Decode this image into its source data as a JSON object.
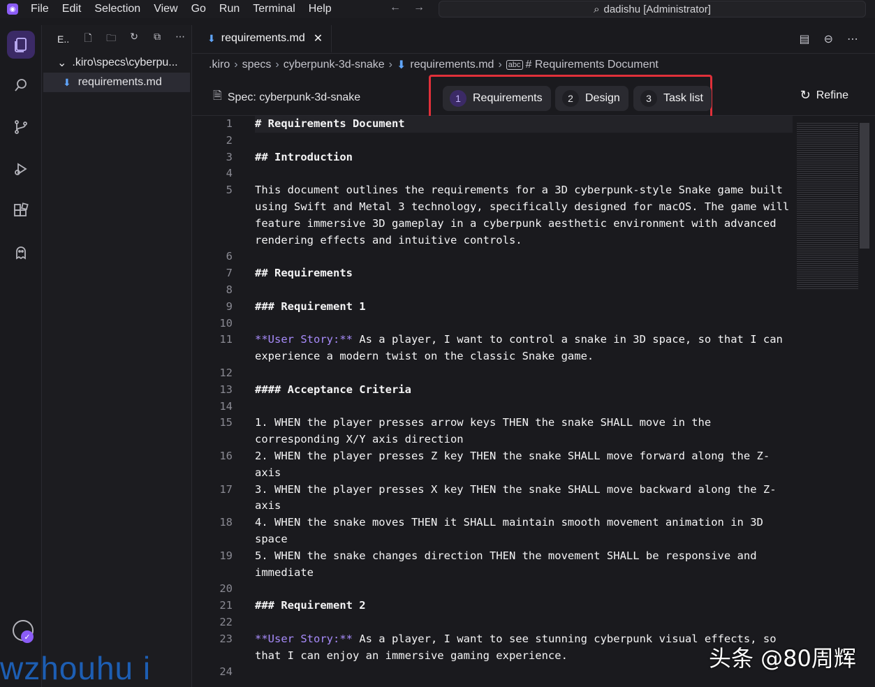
{
  "menubar": {
    "items": [
      "File",
      "Edit",
      "Selection",
      "View",
      "Go",
      "Run",
      "Terminal",
      "Help"
    ],
    "search_text": "dadishu [Administrator]"
  },
  "sidebar": {
    "title": "E..",
    "tree": [
      {
        "label": ".kiro\\specs\\cyberpu..."
      },
      {
        "label": "requirements.md"
      }
    ]
  },
  "editor": {
    "tab_label": "requirements.md",
    "breadcrumb": [
      ".kiro",
      "specs",
      "cyberpunk-3d-snake",
      "requirements.md",
      "# Requirements Document"
    ],
    "spec_title": "Spec: cyberpunk-3d-snake",
    "steps": [
      {
        "num": "1",
        "label": "Requirements"
      },
      {
        "num": "2",
        "label": "Design"
      },
      {
        "num": "3",
        "label": "Task list"
      }
    ],
    "refine_label": "Refine",
    "lines": [
      {
        "n": "1",
        "t": "# Requirements Document"
      },
      {
        "n": "2",
        "t": ""
      },
      {
        "n": "3",
        "t": "## Introduction"
      },
      {
        "n": "4",
        "t": ""
      },
      {
        "n": "5",
        "t": "This document outlines the requirements for a 3D cyberpunk-style Snake game built using Swift and Metal 3 technology, specifically designed for macOS. The game will feature immersive 3D gameplay in a cyberpunk aesthetic environment with advanced rendering effects and intuitive controls."
      },
      {
        "n": "6",
        "t": ""
      },
      {
        "n": "7",
        "t": "## Requirements"
      },
      {
        "n": "8",
        "t": ""
      },
      {
        "n": "9",
        "t": "### Requirement 1"
      },
      {
        "n": "10",
        "t": ""
      },
      {
        "n": "11",
        "k": "**User Story:**",
        "t": " As a player, I want to control a snake in 3D space, so that I can experience a modern twist on the classic Snake game."
      },
      {
        "n": "12",
        "t": ""
      },
      {
        "n": "13",
        "t": "#### Acceptance Criteria"
      },
      {
        "n": "14",
        "t": ""
      },
      {
        "n": "15",
        "t": "1. WHEN the player presses arrow keys THEN the snake SHALL move in the corresponding X/Y axis direction"
      },
      {
        "n": "16",
        "t": "2. WHEN the player presses Z key THEN the snake SHALL move forward along the Z-axis"
      },
      {
        "n": "17",
        "t": "3. WHEN the player presses X key THEN the snake SHALL move backward along the Z-axis"
      },
      {
        "n": "18",
        "t": "4. WHEN the snake moves THEN it SHALL maintain smooth movement animation in 3D space"
      },
      {
        "n": "19",
        "t": "5. WHEN the snake changes direction THEN the movement SHALL be responsive and immediate"
      },
      {
        "n": "20",
        "t": ""
      },
      {
        "n": "21",
        "t": "### Requirement 2"
      },
      {
        "n": "22",
        "t": ""
      },
      {
        "n": "23",
        "k": "**User Story:**",
        "t": " As a player, I want to see stunning cyberpunk visual effects, so that I can enjoy an immersive gaming experience."
      },
      {
        "n": "24",
        "t": ""
      }
    ]
  },
  "watermarks": {
    "left": "wzhouhu i",
    "right": "头条 @80周辉"
  },
  "colors": {
    "accent": "#8b5cf6",
    "highlight_box": "#e0303a",
    "link": "#60a5fa"
  }
}
